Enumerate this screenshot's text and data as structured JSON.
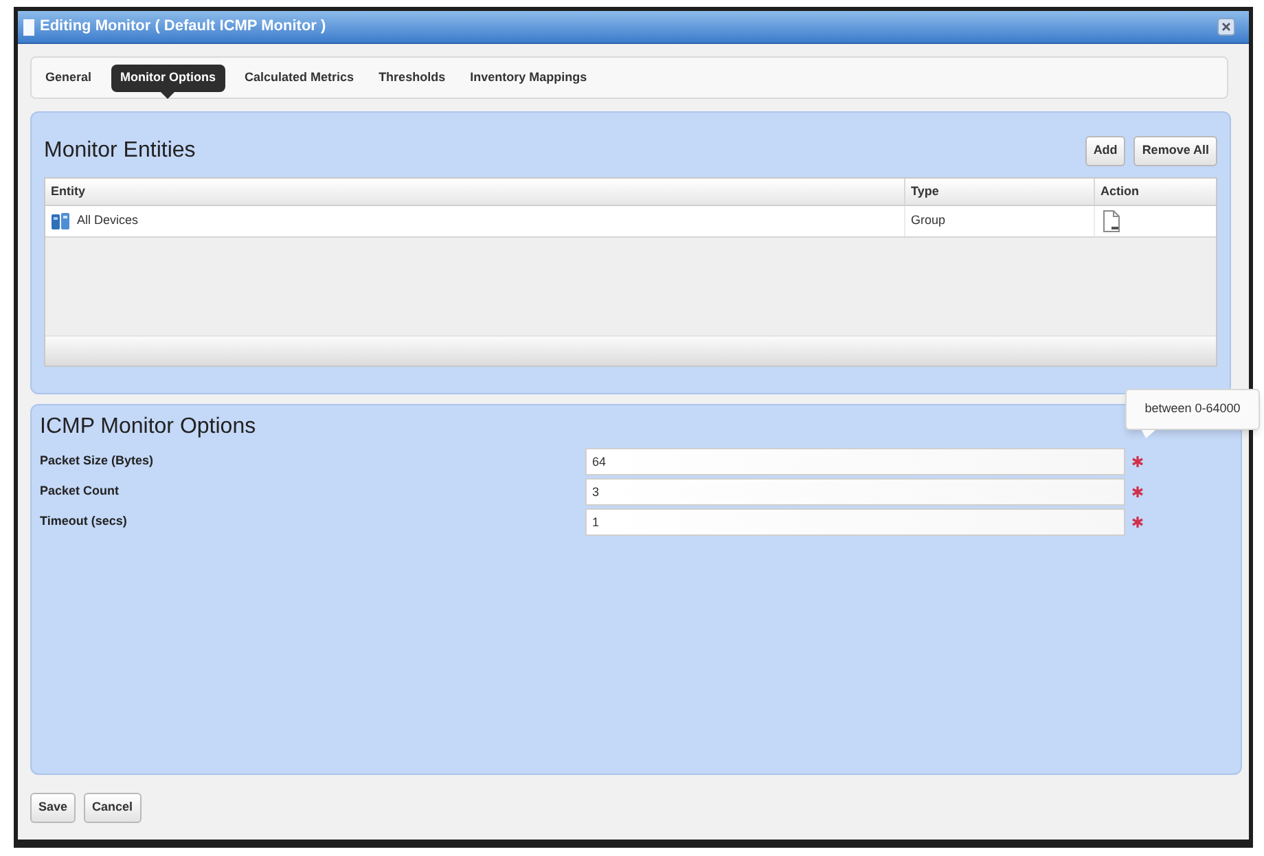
{
  "window": {
    "title": "Editing Monitor ( Default ICMP Monitor )"
  },
  "tabs": [
    {
      "label": "General",
      "selected": false
    },
    {
      "label": "Monitor Options",
      "selected": true
    },
    {
      "label": "Calculated Metrics",
      "selected": false
    },
    {
      "label": "Thresholds",
      "selected": false
    },
    {
      "label": "Inventory Mappings",
      "selected": false
    }
  ],
  "monitor_entities": {
    "title": "Monitor Entities",
    "buttons": [
      "Add",
      "Remove All"
    ],
    "columns": [
      "Entity",
      "Type",
      "Action"
    ],
    "rows": [
      {
        "entity": "All Devices",
        "type": "Group"
      }
    ]
  },
  "icmp_options": {
    "title": "ICMP Monitor Options",
    "tooltip": "between 0-64000",
    "fields": [
      {
        "label": "Packet Size (Bytes)",
        "value": "64",
        "required": true
      },
      {
        "label": "Packet Count",
        "value": "3",
        "required": true
      },
      {
        "label": "Timeout (secs)",
        "value": "1",
        "required": true
      }
    ]
  },
  "buttons": [
    "Save",
    "Cancel"
  ]
}
